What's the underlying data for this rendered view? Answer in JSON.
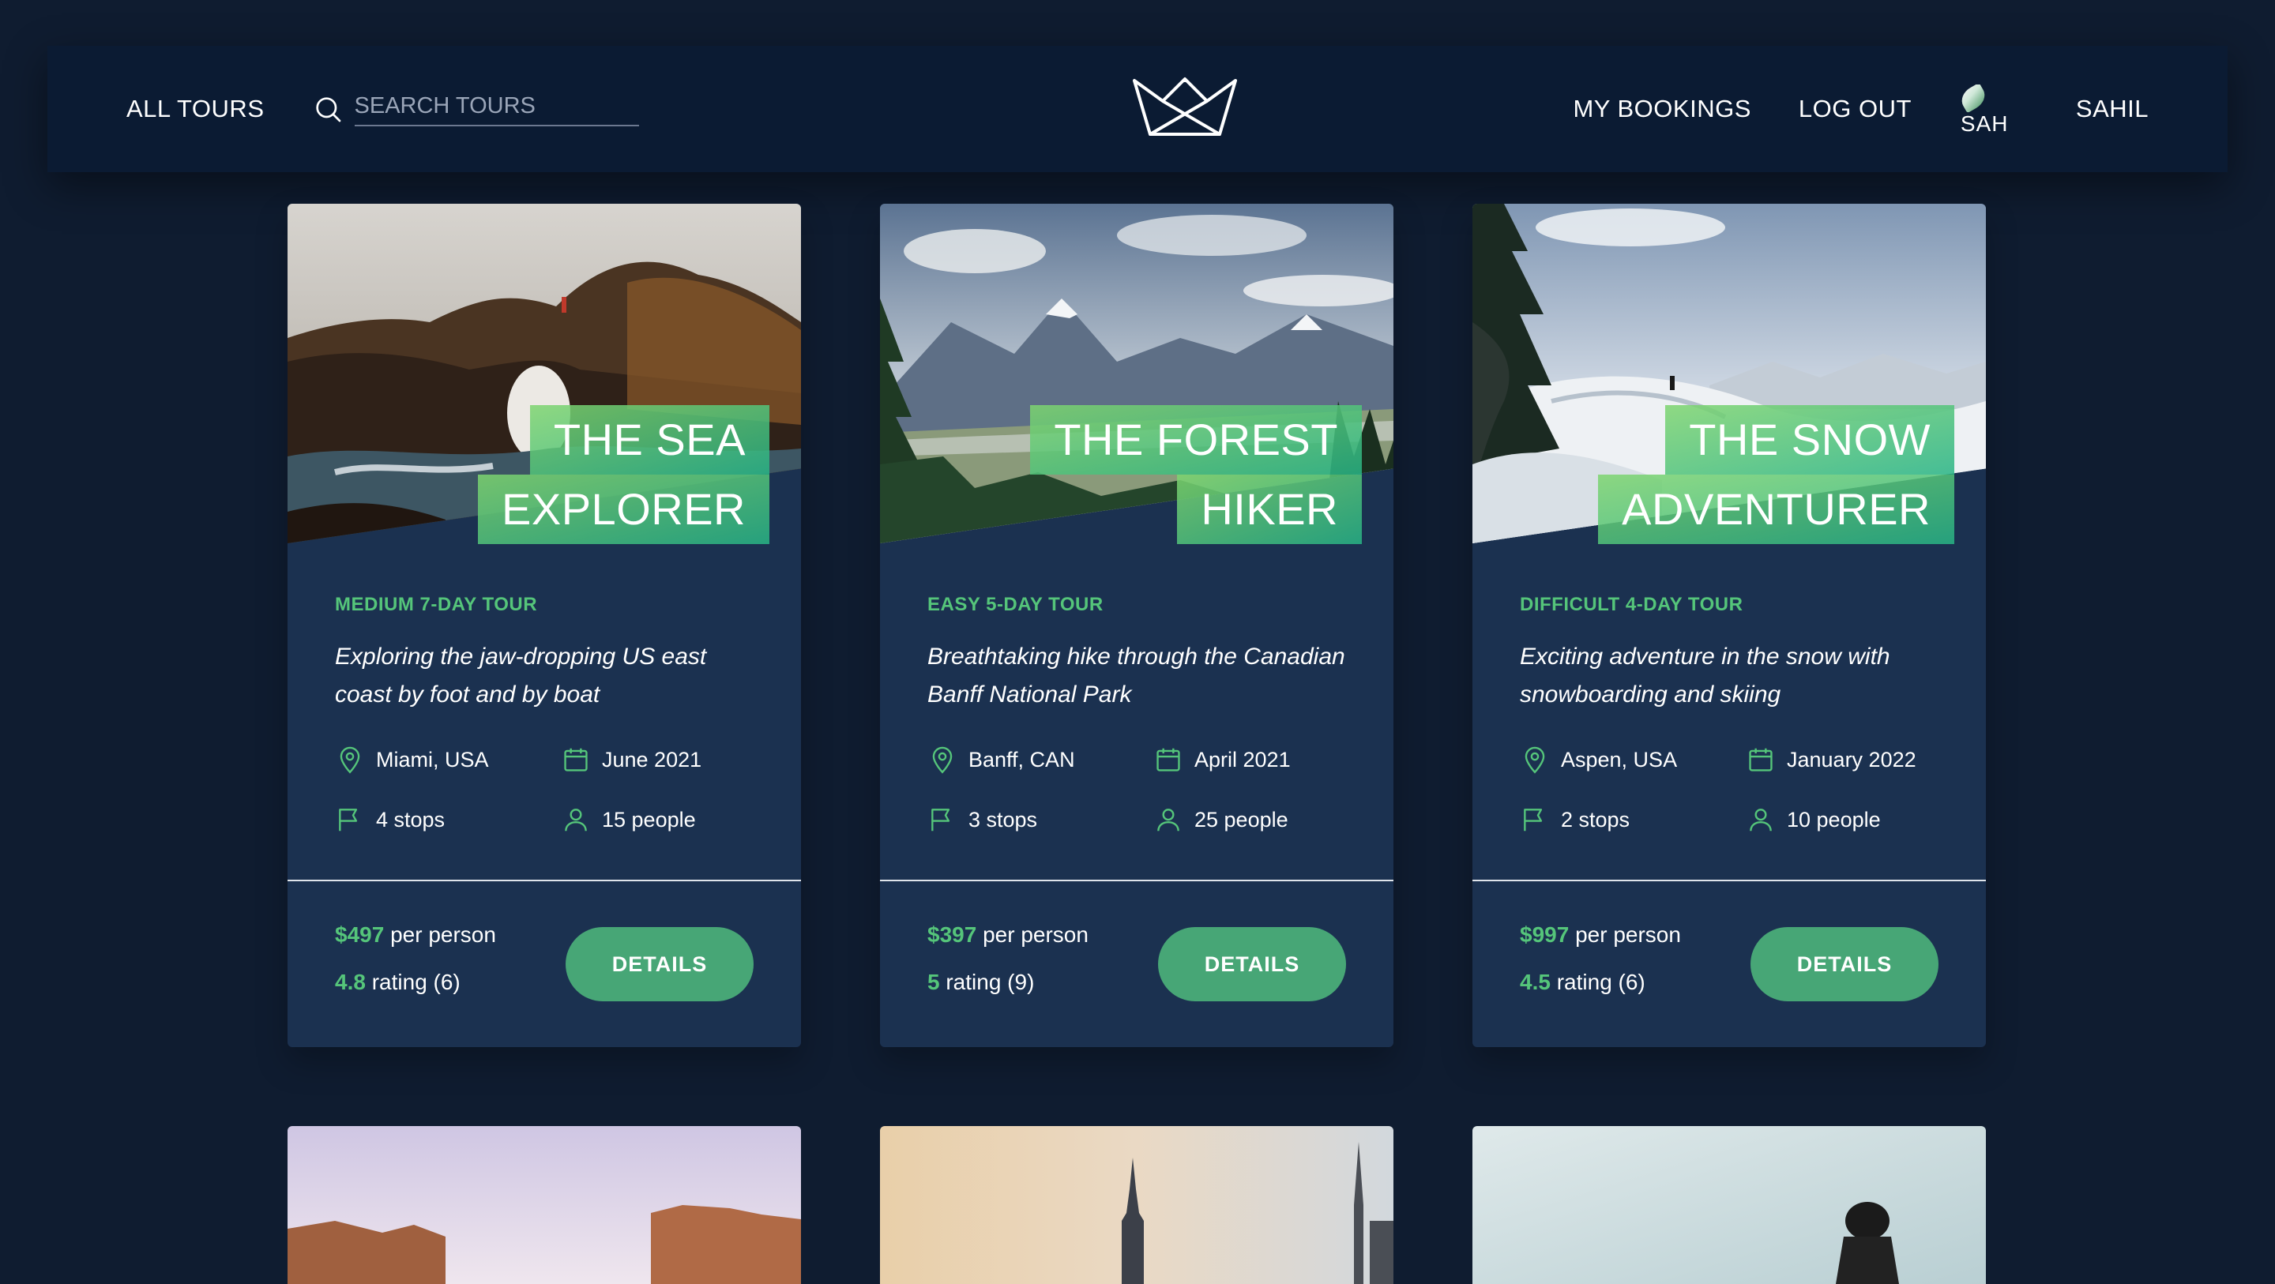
{
  "header": {
    "all_tours": "ALL TOURS",
    "search_placeholder": "SEARCH TOURS",
    "my_bookings": "MY BOOKINGS",
    "log_out": "LOG OUT",
    "avatar_alt": "SAH",
    "user_name": "SAHIL"
  },
  "colors": {
    "background": "#0f1c30",
    "header": "#0b1b33",
    "card": "#1b3150",
    "accent_green": "#55c57a",
    "button_green": "#47a676"
  },
  "cards": [
    {
      "title_line1": "THE SEA",
      "title_line2": "EXPLORER",
      "subheading": "MEDIUM 7-DAY TOUR",
      "summary": "Exploring the jaw-dropping US east coast by foot and by boat",
      "location": "Miami, USA",
      "date": "June 2021",
      "stops": "4 stops",
      "people": "15 people",
      "price": "$497",
      "price_label": "per person",
      "rating": "4.8",
      "rating_label": "rating (6)",
      "button": "DETAILS"
    },
    {
      "title_line1": "THE FOREST",
      "title_line2": "HIKER",
      "subheading": "EASY 5-DAY TOUR",
      "summary": "Breathtaking hike through the Canadian Banff National Park",
      "location": "Banff, CAN",
      "date": "April 2021",
      "stops": "3 stops",
      "people": "25 people",
      "price": "$397",
      "price_label": "per person",
      "rating": "5",
      "rating_label": "rating (9)",
      "button": "DETAILS"
    },
    {
      "title_line1": "THE SNOW",
      "title_line2": "ADVENTURER",
      "subheading": "DIFFICULT 4-DAY TOUR",
      "summary": "Exciting adventure in the snow with snowboarding and skiing",
      "location": "Aspen, USA",
      "date": "January 2022",
      "stops": "2 stops",
      "people": "10 people",
      "price": "$997",
      "price_label": "per person",
      "rating": "4.5",
      "rating_label": "rating (6)",
      "button": "DETAILS"
    }
  ],
  "icons": {
    "search": "search-icon",
    "logo": "crown-logo",
    "location": "map-pin-icon",
    "date": "calendar-icon",
    "stops": "flag-icon",
    "people": "user-icon"
  }
}
